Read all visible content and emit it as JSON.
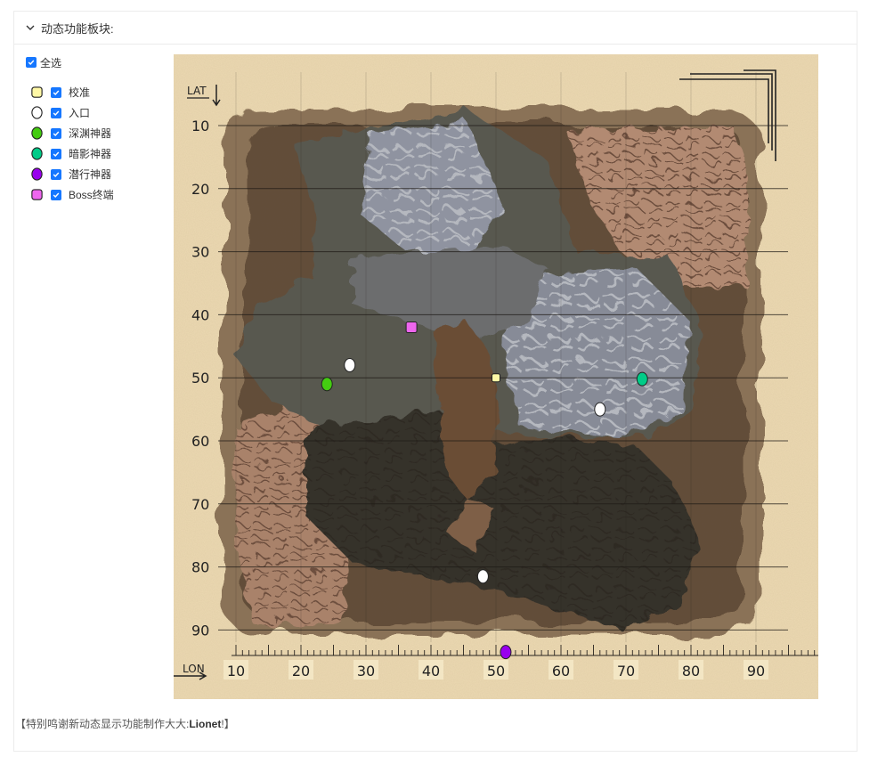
{
  "panel": {
    "title": "动态功能板块:"
  },
  "legend": {
    "select_all": "全选",
    "items": [
      {
        "label": "校准",
        "shape": "square",
        "color": "#fff8a6",
        "checked": true
      },
      {
        "label": "入口",
        "shape": "circle",
        "color": "#ffffff",
        "checked": true
      },
      {
        "label": "深渊神器",
        "shape": "circle",
        "color": "#44cc11",
        "checked": true
      },
      {
        "label": "暗影神器",
        "shape": "circle",
        "color": "#00cc88",
        "checked": true
      },
      {
        "label": "潜行神器",
        "shape": "circle",
        "color": "#9900ee",
        "checked": true
      },
      {
        "label": "Boss终端",
        "shape": "square",
        "color": "#ee66ee",
        "checked": true
      }
    ]
  },
  "map": {
    "lat_label": "LAT",
    "lon_label": "LON",
    "lat_ticks": [
      "10",
      "20",
      "30",
      "40",
      "50",
      "60",
      "70",
      "80",
      "90"
    ],
    "lon_ticks": [
      "10",
      "20",
      "30",
      "40",
      "50",
      "60",
      "70",
      "80",
      "90"
    ],
    "markers": [
      {
        "type": "校准",
        "lat": 50.0,
        "lon": 50.0
      },
      {
        "type": "入口",
        "lat": 48.0,
        "lon": 27.5
      },
      {
        "type": "入口",
        "lat": 55.0,
        "lon": 66.0
      },
      {
        "type": "入口",
        "lat": 81.5,
        "lon": 48.0
      },
      {
        "type": "深渊神器",
        "lat": 51.0,
        "lon": 24.0
      },
      {
        "type": "暗影神器",
        "lat": 50.2,
        "lon": 72.5
      },
      {
        "type": "潜行神器",
        "lat": 93.5,
        "lon": 51.5
      },
      {
        "type": "Boss终端",
        "lat": 42.0,
        "lon": 37.0
      }
    ]
  },
  "footer": {
    "prefix": "【特别鸣谢新动态显示功能制作大大:",
    "name": "Lionet",
    "suffix": "!】"
  }
}
